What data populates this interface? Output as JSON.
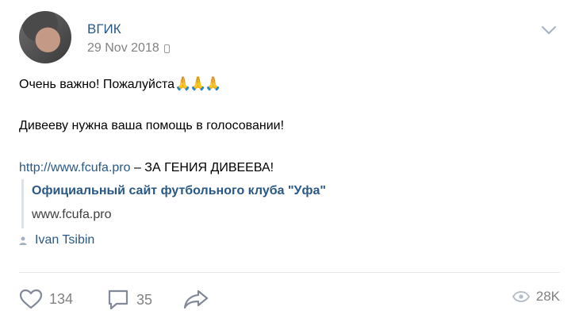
{
  "post": {
    "author": "ВГИК",
    "date": "29 Nov 2018",
    "line1": "Очень важно! Пожалуйста",
    "line1_emoji": "🙏🙏🙏",
    "line2": "Дивееву нужна ваша помощь в голосовании!",
    "link_url": "http://www.fcufa.pro",
    "link_suffix": " – ЗА ГЕНИЯ ДИВЕЕВА!",
    "snippet": {
      "title": "Официальный сайт футбольного клуба \"Уфа\"",
      "domain": "www.fcufa.pro"
    },
    "signer": "Ivan Tsibin"
  },
  "actions": {
    "likes": "134",
    "comments": "35",
    "views": "28K"
  },
  "icons": {
    "menu": "chevron-down-icon",
    "device": "phone-icon",
    "signer": "user-icon",
    "like": "heart-icon",
    "comment": "comment-icon",
    "share": "share-icon",
    "views": "eye-icon"
  },
  "colors": {
    "link": "#2a5885",
    "muted": "#828282",
    "divider": "#e7e8ec",
    "quote_bar": "#dbe2ea"
  }
}
